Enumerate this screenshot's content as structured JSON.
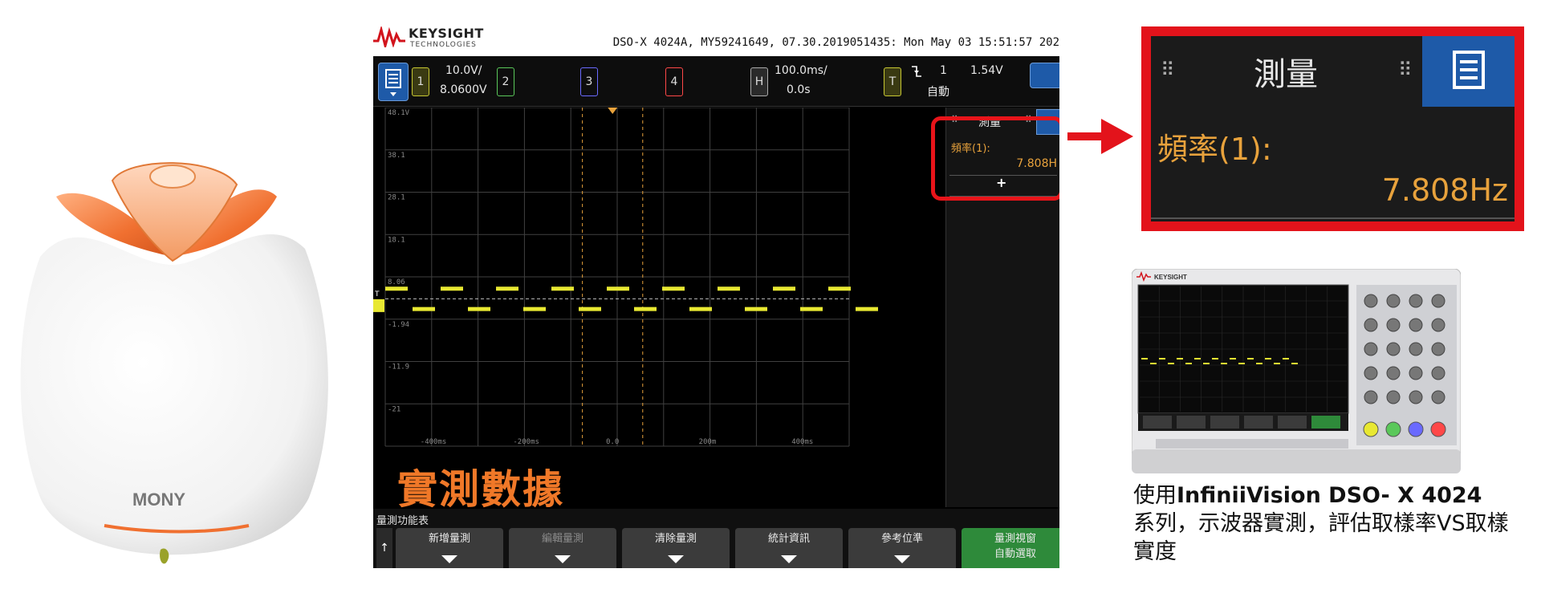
{
  "scope": {
    "brand_name": "KEYSIGHT",
    "brand_sub": "TECHNOLOGIES",
    "header": "DSO-X 4024A, MY59241649, 07.30.2019051435: Mon May 03 15:51:57 202",
    "ch1": {
      "label": "1",
      "scale": "10.0V/",
      "offset": "8.0600V"
    },
    "ch2_label": "2",
    "ch3_label": "3",
    "ch4_label": "4",
    "horizontal": {
      "label": "H",
      "scale": "100.0ms/",
      "delay": "0.0s"
    },
    "trigger": {
      "label": "T",
      "slope_icon": "falling-edge",
      "channel": "1",
      "level": "1.54V",
      "mode": "自動"
    },
    "y_ticks": [
      "48.1V",
      "38.1",
      "28.1",
      "18.1",
      "8.06",
      "-1.94",
      "-11.9",
      "-21"
    ],
    "x_ticks": [
      "-400ms",
      "-200ms",
      "0.0",
      "200m",
      "400ms"
    ],
    "measurement": {
      "title": "測量",
      "name": "頻率(1):",
      "value": "7.808H",
      "add": "+"
    },
    "softkey_title": "量測功能表",
    "softkeys": [
      "新增量測",
      "編輯量測",
      "清除量測",
      "統計資訊",
      "參考位準",
      "量測視窗\n自動選取"
    ],
    "overlay_label": "實測數據",
    "colors": {
      "ch1": "#e8e832",
      "ch2": "#5ac85a",
      "ch3": "#6a6aff",
      "ch4": "#ff4848",
      "accent": "#e8141a"
    }
  },
  "zoom": {
    "title": "測量",
    "name": "頻率(1):",
    "value": "7.808Hz"
  },
  "product": {
    "brand": "MONY"
  },
  "caption": {
    "part1": "使用",
    "model": "InfiniiVision DSO- X 4024",
    "part2": " 系列，示波器實測，評估取樣率VS取樣實度"
  },
  "instrument": {
    "brand": "KEYSIGHT"
  }
}
